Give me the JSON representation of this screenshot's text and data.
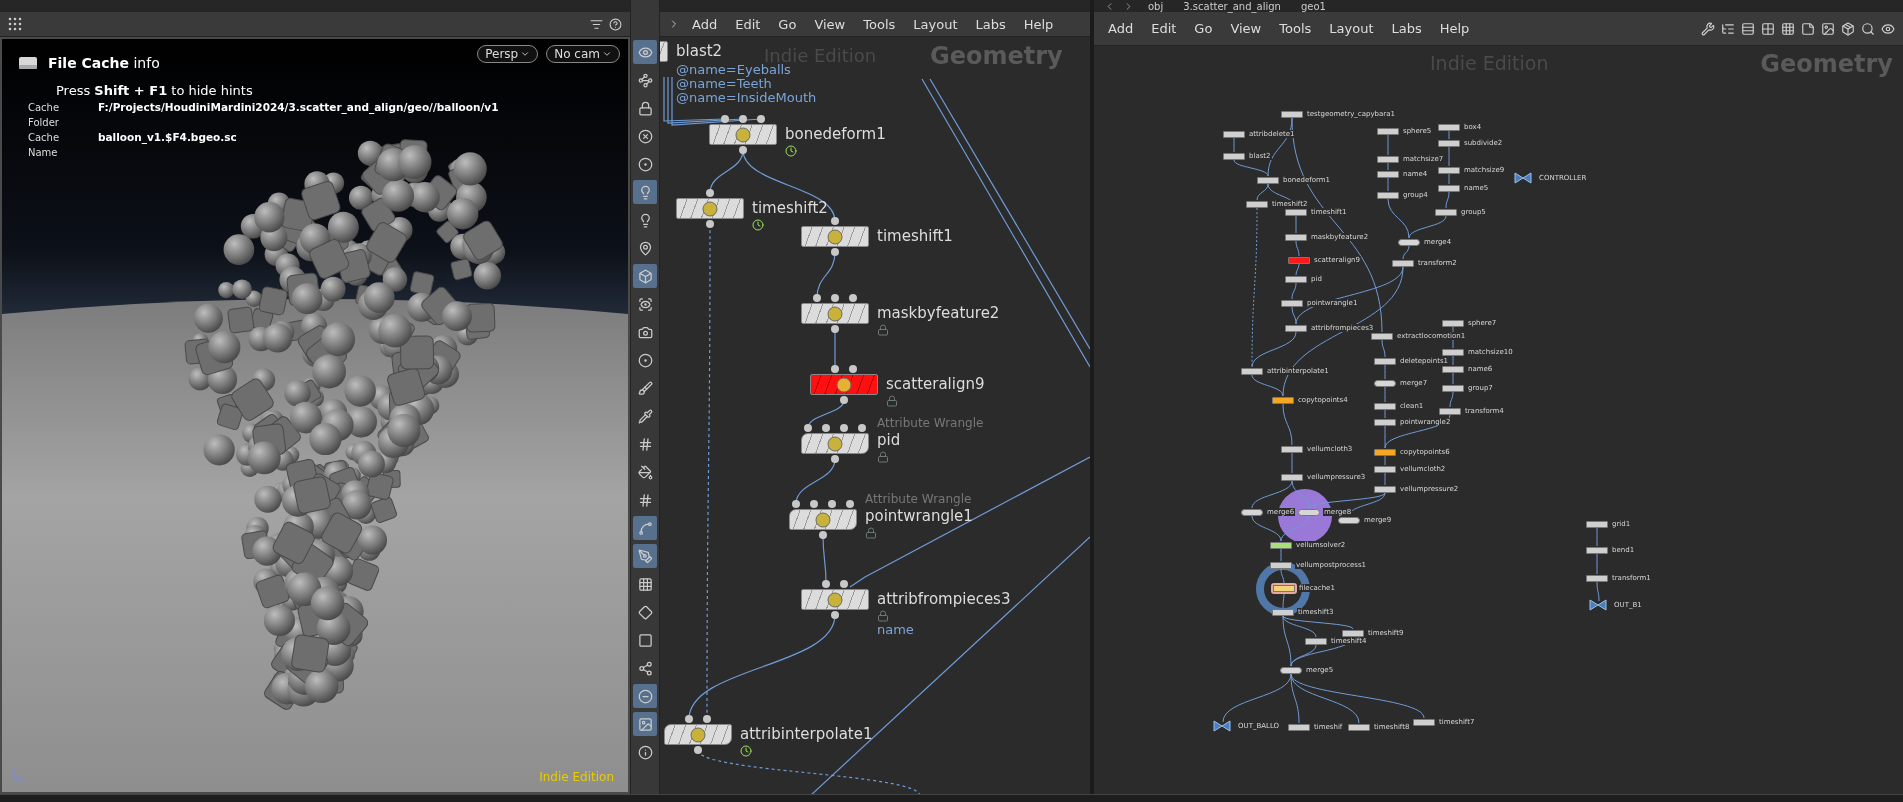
{
  "viewport": {
    "title": "File Cache",
    "title_suffix": "info",
    "hint": "Press **Shift + F1** to hide hints",
    "fields": [
      {
        "label": "Cache Folder",
        "value": "F:/Projects/HoudiniMardini2024/3.scatter_and_align/geo//balloon/v1"
      },
      {
        "label": "Cache Name",
        "value": "balloon_v1.$F4.bgeo.sc"
      }
    ],
    "view_menus": [
      "Persp",
      "No cam"
    ],
    "edition": "Indie Edition"
  },
  "tools": [
    {
      "selected": true
    },
    {
      "selected": false
    },
    {
      "selected": false
    },
    {
      "selected": false
    },
    {
      "selected": false
    },
    {
      "selected": true
    },
    {
      "selected": false
    },
    {
      "selected": false
    },
    {
      "selected": true
    },
    {
      "selected": false
    },
    {
      "selected": false
    },
    {
      "selected": false
    },
    {
      "selected": false
    },
    {
      "selected": false
    },
    {
      "selected": false
    },
    {
      "selected": false
    },
    {
      "selected": false
    },
    {
      "selected": true
    },
    {
      "selected": true
    },
    {
      "selected": false
    },
    {
      "selected": false
    },
    {
      "selected": false
    },
    {
      "selected": false
    },
    {
      "selected": true
    },
    {
      "selected": true
    },
    {
      "selected": false
    }
  ],
  "left_network": {
    "menu": [
      "Add",
      "Edit",
      "Go",
      "View",
      "Tools",
      "Layout",
      "Labs",
      "Help"
    ],
    "edition": "Indie Edition",
    "context": "Geometry",
    "nodes": [
      {
        "name": "blast2",
        "kind": "standard",
        "locked": false,
        "time_dependent": false,
        "sublabels": [
          "@name=Eyeballs",
          "@name=Teeth",
          "@name=InsideMouth"
        ]
      },
      {
        "name": "bonedeform1",
        "kind": "standard",
        "locked": false,
        "time_dependent": true
      },
      {
        "name": "timeshift2",
        "kind": "standard",
        "locked": false,
        "time_dependent": true
      },
      {
        "name": "timeshift1",
        "kind": "standard",
        "locked": false,
        "time_dependent": false
      },
      {
        "name": "maskbyfeature2",
        "kind": "standard",
        "locked": true,
        "time_dependent": false
      },
      {
        "name": "scatteralign9",
        "kind": "error",
        "locked": true,
        "time_dependent": false
      },
      {
        "name": "pid",
        "kind": "wrangle",
        "type_label": "Attribute Wrangle",
        "locked": true,
        "time_dependent": false
      },
      {
        "name": "pointwrangle1",
        "kind": "wrangle",
        "type_label": "Attribute Wrangle",
        "locked": true,
        "time_dependent": false
      },
      {
        "name": "attribfrompieces3",
        "kind": "standard",
        "locked": true,
        "time_dependent": false,
        "sublabels": [
          "name"
        ]
      },
      {
        "name": "attribinterpolate1",
        "kind": "wrangle",
        "locked": false,
        "time_dependent": true
      }
    ]
  },
  "right_network": {
    "path": [
      "obj",
      "3.scatter_and_align",
      "geo1"
    ],
    "menu": [
      "Add",
      "Edit",
      "Go",
      "View",
      "Tools",
      "Layout",
      "Labs",
      "Help"
    ],
    "edition": "Indie Edition",
    "context": "Geometry",
    "nodes": [
      {
        "name": "testgeometry_capybara1",
        "kind": "standard"
      },
      {
        "name": "attribdelete1",
        "kind": "standard"
      },
      {
        "name": "blast2",
        "kind": "standard"
      },
      {
        "name": "bonedeform1",
        "kind": "standard"
      },
      {
        "name": "timeshift2",
        "kind": "standard"
      },
      {
        "name": "timeshift1",
        "kind": "standard"
      },
      {
        "name": "maskbyfeature2",
        "kind": "standard"
      },
      {
        "name": "scatteralign9",
        "kind": "error"
      },
      {
        "name": "pid",
        "kind": "standard"
      },
      {
        "name": "pointwrangle1",
        "kind": "standard"
      },
      {
        "name": "attribfrompieces3",
        "kind": "standard"
      },
      {
        "name": "attribinterpolate1",
        "kind": "standard"
      },
      {
        "name": "copytopoints4",
        "kind": "copy"
      },
      {
        "name": "vellumcloth3",
        "kind": "standard"
      },
      {
        "name": "vellumpressure3",
        "kind": "standard"
      },
      {
        "name": "sphere5",
        "kind": "standard"
      },
      {
        "name": "matchsize7",
        "kind": "standard"
      },
      {
        "name": "name4",
        "kind": "standard"
      },
      {
        "name": "group4",
        "kind": "standard"
      },
      {
        "name": "box4",
        "kind": "standard"
      },
      {
        "name": "subdivide2",
        "kind": "standard"
      },
      {
        "name": "matchsize9",
        "kind": "standard"
      },
      {
        "name": "name5",
        "kind": "standard"
      },
      {
        "name": "group5",
        "kind": "standard"
      },
      {
        "name": "merge4",
        "kind": "merge"
      },
      {
        "name": "transform2",
        "kind": "standard"
      },
      {
        "name": "extractlocomotion1",
        "kind": "standard"
      },
      {
        "name": "deletepoints1",
        "kind": "standard"
      },
      {
        "name": "merge7",
        "kind": "merge"
      },
      {
        "name": "clean1",
        "kind": "standard"
      },
      {
        "name": "pointwrangle2",
        "kind": "standard"
      },
      {
        "name": "copytopoints6",
        "kind": "copy"
      },
      {
        "name": "vellumcloth2",
        "kind": "standard"
      },
      {
        "name": "vellumpressure2",
        "kind": "standard"
      },
      {
        "name": "sphere7",
        "kind": "standard"
      },
      {
        "name": "matchsize10",
        "kind": "standard"
      },
      {
        "name": "name6",
        "kind": "standard"
      },
      {
        "name": "group7",
        "kind": "standard"
      },
      {
        "name": "transform4",
        "kind": "standard"
      },
      {
        "name": "CONTROLLER",
        "kind": "null"
      },
      {
        "name": "merge6",
        "kind": "merge"
      },
      {
        "name": "merge8",
        "kind": "merge"
      },
      {
        "name": "merge9",
        "kind": "merge"
      },
      {
        "name": "vellumsolver2",
        "kind": "solver"
      },
      {
        "name": "vellumpostprocess1",
        "kind": "standard"
      },
      {
        "name": "filecache1",
        "kind": "cache"
      },
      {
        "name": "timeshift3",
        "kind": "standard"
      },
      {
        "name": "timeshift4",
        "kind": "standard"
      },
      {
        "name": "timeshift9",
        "kind": "standard"
      },
      {
        "name": "merge5",
        "kind": "merge"
      },
      {
        "name": "OUT_BALLO",
        "kind": "null"
      },
      {
        "name": "timeshif",
        "kind": "standard"
      },
      {
        "name": "timeshift8",
        "kind": "standard"
      },
      {
        "name": "timeshift7",
        "kind": "standard"
      },
      {
        "name": "grid1",
        "kind": "standard"
      },
      {
        "name": "bend1",
        "kind": "standard"
      },
      {
        "name": "transform1",
        "kind": "standard"
      },
      {
        "name": "OUT_B1",
        "kind": "null"
      }
    ]
  }
}
